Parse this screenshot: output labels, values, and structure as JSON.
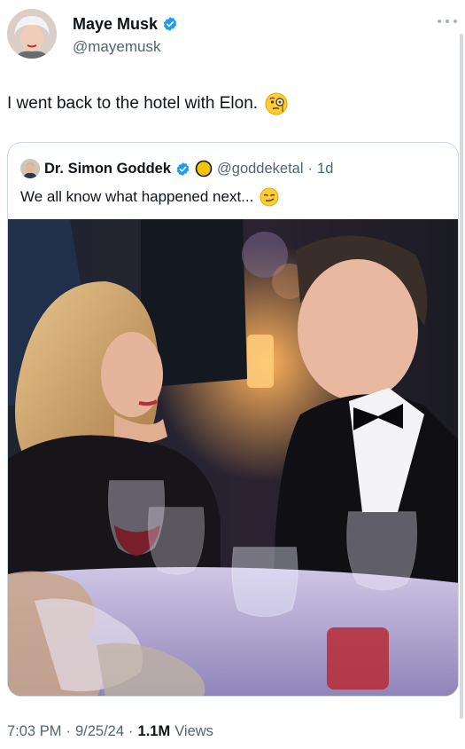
{
  "author": {
    "display_name": "Maye Musk",
    "handle": "@mayemusk",
    "verified": true,
    "avatar_icon": "profile-photo"
  },
  "tweet": {
    "text": "I went back to the hotel with Elon.",
    "emoji_icon": "monocle-face-emoji"
  },
  "quoted_tweet": {
    "display_name": "Dr. Simon Goddek",
    "handle": "@goddeketal",
    "time": "1d",
    "separator": "·",
    "text": "We all know what happened next...",
    "emoji_icon": "smirking-face-emoji",
    "badges": [
      "verified-badge-icon",
      "gold-circle-icon"
    ]
  },
  "meta": {
    "time": "7:03 PM",
    "date": "9/25/24",
    "sep1": "·",
    "sep2": "·",
    "views_count": "1.1M",
    "views_label": "Views"
  },
  "colors": {
    "verified_blue": "#1d9bf0",
    "secondary_text": "#536471",
    "border": "#cfd9de"
  }
}
